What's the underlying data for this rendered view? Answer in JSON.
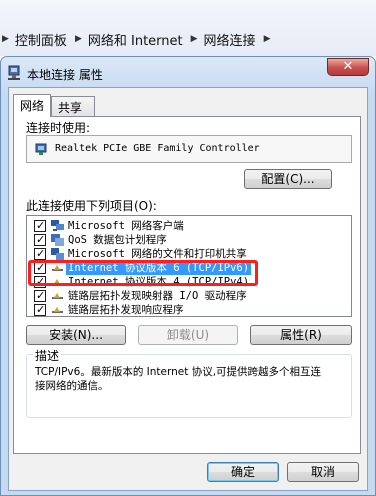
{
  "breadcrumb": {
    "items": [
      "控制面板",
      "网络和 Internet",
      "网络连接"
    ]
  },
  "dialog": {
    "title": "本地连接 属性",
    "close_label": "✕",
    "tabs": [
      {
        "label": "网络"
      },
      {
        "label": "共享"
      }
    ],
    "connect_using_label": "连接时使用:",
    "adapter_name": "Realtek PCIe GBE Family Controller",
    "configure_button": "配置(C)...",
    "items_label": "此连接使用下列项目(O):",
    "items": [
      {
        "label": "Microsoft 网络客户端",
        "checked": true,
        "icon": "network-client-icon"
      },
      {
        "label": "QoS 数据包计划程序",
        "checked": true,
        "icon": "qos-scheduler-icon"
      },
      {
        "label": "Microsoft 网络的文件和打印机共享",
        "checked": true,
        "icon": "file-printer-sharing-icon"
      },
      {
        "label": "Internet 协议版本 6 (TCP/IPv6)",
        "checked": true,
        "icon": "protocol-icon",
        "selected": true
      },
      {
        "label": "Internet 协议版本 4 (TCP/IPv4)",
        "checked": true,
        "icon": "protocol-icon"
      },
      {
        "label": "链路层拓扑发现映射器 I/O 驱动程序",
        "checked": true,
        "icon": "protocol-icon"
      },
      {
        "label": "链路层拓扑发现响应程序",
        "checked": true,
        "icon": "protocol-icon"
      }
    ],
    "install_button": "安装(N)...",
    "uninstall_button": "卸载(U)",
    "properties_button": "属性(R)",
    "description_label": "描述",
    "description_text": "TCP/IPv6。最新版本的 Internet 协议,可提供跨越多个相互连接网络的通信。",
    "ok_button": "确定",
    "cancel_button": "取消"
  },
  "colors": {
    "highlight_box": "#ff1e1e",
    "selection": "#3399ff"
  }
}
